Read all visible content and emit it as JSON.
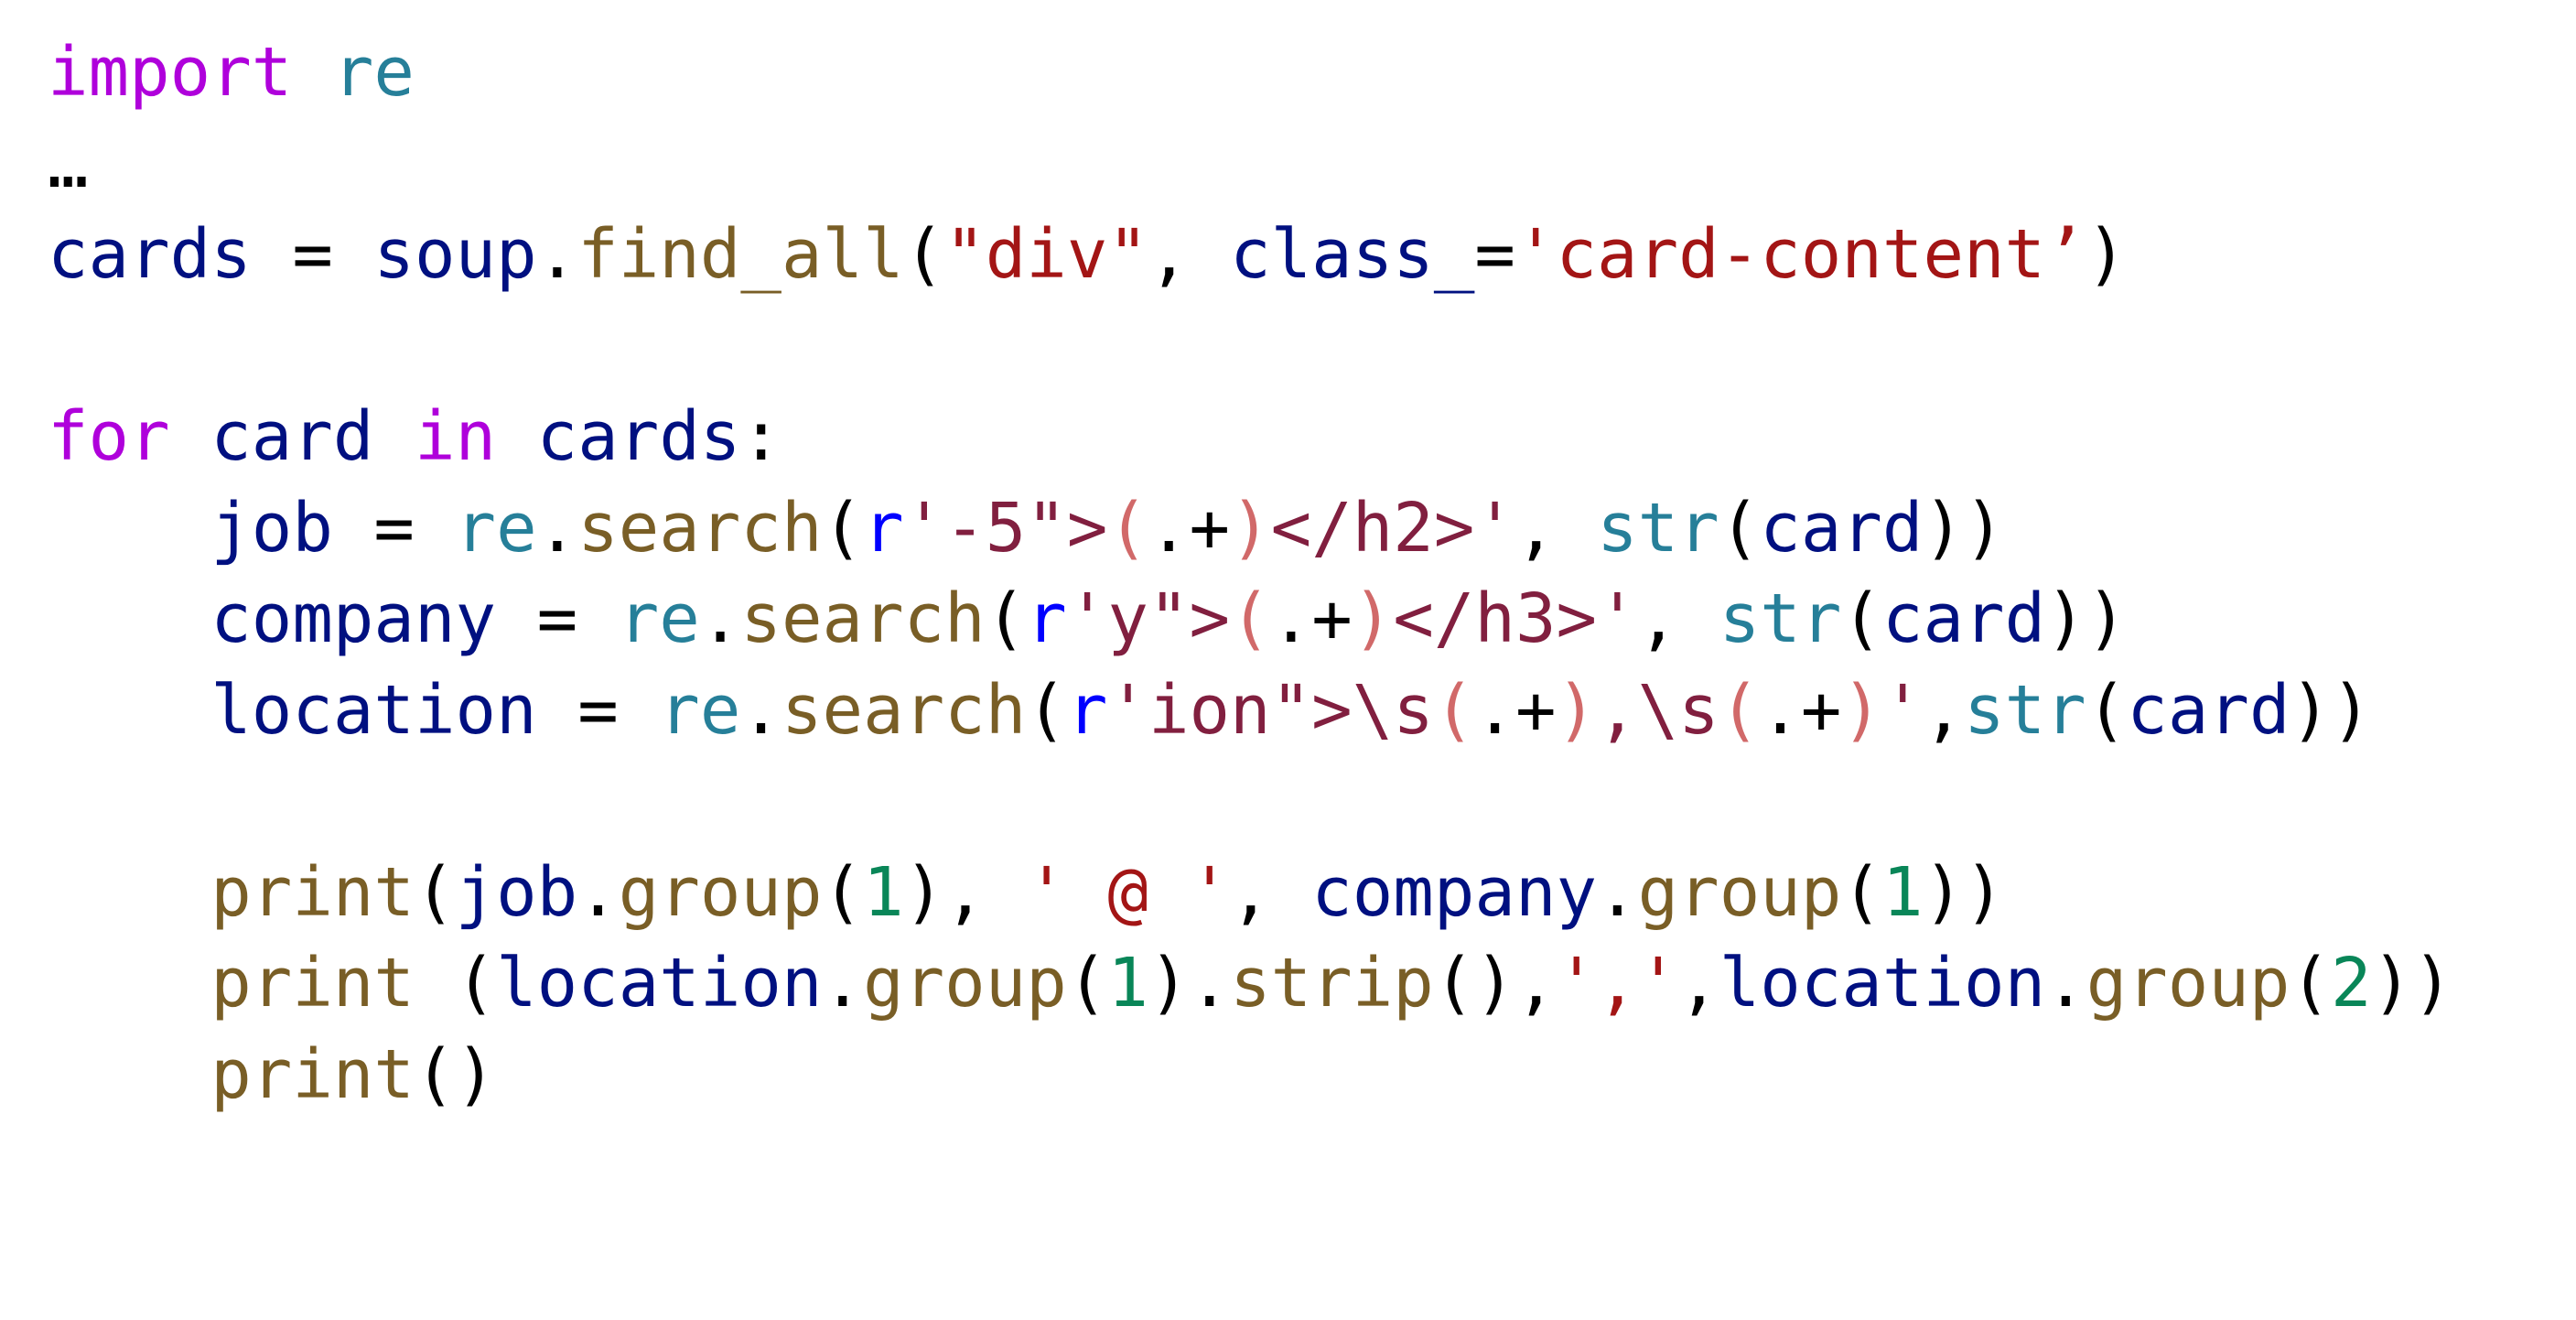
{
  "colors": {
    "keyword": "#af00db",
    "module": "#267f99",
    "variable": "#001080",
    "function": "#795e26",
    "string": "#a31515",
    "regex_prefix": "#0000ff",
    "regex_body": "#811f3f",
    "regex_group": "#d16969",
    "number": "#098658",
    "plain": "#000000"
  },
  "lines": [
    [
      {
        "t": "import",
        "c": "keyword"
      },
      {
        "t": " ",
        "c": "plain"
      },
      {
        "t": "re",
        "c": "module"
      }
    ],
    [
      {
        "t": "…",
        "c": "plain"
      }
    ],
    [
      {
        "t": "cards",
        "c": "variable"
      },
      {
        "t": " = ",
        "c": "plain"
      },
      {
        "t": "soup",
        "c": "variable"
      },
      {
        "t": ".",
        "c": "plain"
      },
      {
        "t": "find_all",
        "c": "function"
      },
      {
        "t": "(",
        "c": "plain"
      },
      {
        "t": "\"div\"",
        "c": "string"
      },
      {
        "t": ", ",
        "c": "plain"
      },
      {
        "t": "class_",
        "c": "variable"
      },
      {
        "t": "=",
        "c": "plain"
      },
      {
        "t": "'card-content’",
        "c": "string"
      },
      {
        "t": ")",
        "c": "plain"
      }
    ],
    [],
    [
      {
        "t": "for",
        "c": "keyword"
      },
      {
        "t": " ",
        "c": "plain"
      },
      {
        "t": "card",
        "c": "variable"
      },
      {
        "t": " ",
        "c": "plain"
      },
      {
        "t": "in",
        "c": "keyword"
      },
      {
        "t": " ",
        "c": "plain"
      },
      {
        "t": "cards",
        "c": "variable"
      },
      {
        "t": ":",
        "c": "plain"
      }
    ],
    [
      {
        "t": "    ",
        "c": "plain"
      },
      {
        "t": "job",
        "c": "variable"
      },
      {
        "t": " = ",
        "c": "plain"
      },
      {
        "t": "re",
        "c": "module"
      },
      {
        "t": ".",
        "c": "plain"
      },
      {
        "t": "search",
        "c": "function"
      },
      {
        "t": "(",
        "c": "plain"
      },
      {
        "t": "r",
        "c": "regex_prefix"
      },
      {
        "t": "'-5\">",
        "c": "regex_body"
      },
      {
        "t": "(",
        "c": "regex_group"
      },
      {
        "t": ".+",
        "c": "plain"
      },
      {
        "t": ")",
        "c": "regex_group"
      },
      {
        "t": "</h2>'",
        "c": "regex_body"
      },
      {
        "t": ", ",
        "c": "plain"
      },
      {
        "t": "str",
        "c": "module"
      },
      {
        "t": "(",
        "c": "plain"
      },
      {
        "t": "card",
        "c": "variable"
      },
      {
        "t": "))",
        "c": "plain"
      }
    ],
    [
      {
        "t": "    ",
        "c": "plain"
      },
      {
        "t": "company",
        "c": "variable"
      },
      {
        "t": " = ",
        "c": "plain"
      },
      {
        "t": "re",
        "c": "module"
      },
      {
        "t": ".",
        "c": "plain"
      },
      {
        "t": "search",
        "c": "function"
      },
      {
        "t": "(",
        "c": "plain"
      },
      {
        "t": "r",
        "c": "regex_prefix"
      },
      {
        "t": "'y\">",
        "c": "regex_body"
      },
      {
        "t": "(",
        "c": "regex_group"
      },
      {
        "t": ".+",
        "c": "plain"
      },
      {
        "t": ")",
        "c": "regex_group"
      },
      {
        "t": "</h3>'",
        "c": "regex_body"
      },
      {
        "t": ", ",
        "c": "plain"
      },
      {
        "t": "str",
        "c": "module"
      },
      {
        "t": "(",
        "c": "plain"
      },
      {
        "t": "card",
        "c": "variable"
      },
      {
        "t": "))",
        "c": "plain"
      }
    ],
    [
      {
        "t": "    ",
        "c": "plain"
      },
      {
        "t": "location",
        "c": "variable"
      },
      {
        "t": " = ",
        "c": "plain"
      },
      {
        "t": "re",
        "c": "module"
      },
      {
        "t": ".",
        "c": "plain"
      },
      {
        "t": "search",
        "c": "function"
      },
      {
        "t": "(",
        "c": "plain"
      },
      {
        "t": "r",
        "c": "regex_prefix"
      },
      {
        "t": "'ion\">\\s",
        "c": "regex_body"
      },
      {
        "t": "(",
        "c": "regex_group"
      },
      {
        "t": ".+",
        "c": "plain"
      },
      {
        "t": ")",
        "c": "regex_group"
      },
      {
        "t": ",\\s",
        "c": "regex_body"
      },
      {
        "t": "(",
        "c": "regex_group"
      },
      {
        "t": ".+",
        "c": "plain"
      },
      {
        "t": ")",
        "c": "regex_group"
      },
      {
        "t": "'",
        "c": "regex_body"
      },
      {
        "t": ",",
        "c": "plain"
      },
      {
        "t": "str",
        "c": "module"
      },
      {
        "t": "(",
        "c": "plain"
      },
      {
        "t": "card",
        "c": "variable"
      },
      {
        "t": "))",
        "c": "plain"
      }
    ],
    [],
    [
      {
        "t": "    ",
        "c": "plain"
      },
      {
        "t": "print",
        "c": "function"
      },
      {
        "t": "(",
        "c": "plain"
      },
      {
        "t": "job",
        "c": "variable"
      },
      {
        "t": ".",
        "c": "plain"
      },
      {
        "t": "group",
        "c": "function"
      },
      {
        "t": "(",
        "c": "plain"
      },
      {
        "t": "1",
        "c": "number"
      },
      {
        "t": "), ",
        "c": "plain"
      },
      {
        "t": "' @ '",
        "c": "string"
      },
      {
        "t": ", ",
        "c": "plain"
      },
      {
        "t": "company",
        "c": "variable"
      },
      {
        "t": ".",
        "c": "plain"
      },
      {
        "t": "group",
        "c": "function"
      },
      {
        "t": "(",
        "c": "plain"
      },
      {
        "t": "1",
        "c": "number"
      },
      {
        "t": "))",
        "c": "plain"
      }
    ],
    [
      {
        "t": "    ",
        "c": "plain"
      },
      {
        "t": "print",
        "c": "function"
      },
      {
        "t": " (",
        "c": "plain"
      },
      {
        "t": "location",
        "c": "variable"
      },
      {
        "t": ".",
        "c": "plain"
      },
      {
        "t": "group",
        "c": "function"
      },
      {
        "t": "(",
        "c": "plain"
      },
      {
        "t": "1",
        "c": "number"
      },
      {
        "t": ").",
        "c": "plain"
      },
      {
        "t": "strip",
        "c": "function"
      },
      {
        "t": "(),",
        "c": "plain"
      },
      {
        "t": "','",
        "c": "string"
      },
      {
        "t": ",",
        "c": "plain"
      },
      {
        "t": "location",
        "c": "variable"
      },
      {
        "t": ".",
        "c": "plain"
      },
      {
        "t": "group",
        "c": "function"
      },
      {
        "t": "(",
        "c": "plain"
      },
      {
        "t": "2",
        "c": "number"
      },
      {
        "t": "))",
        "c": "plain"
      }
    ],
    [
      {
        "t": "    ",
        "c": "plain"
      },
      {
        "t": "print",
        "c": "function"
      },
      {
        "t": "()",
        "c": "plain"
      }
    ]
  ]
}
